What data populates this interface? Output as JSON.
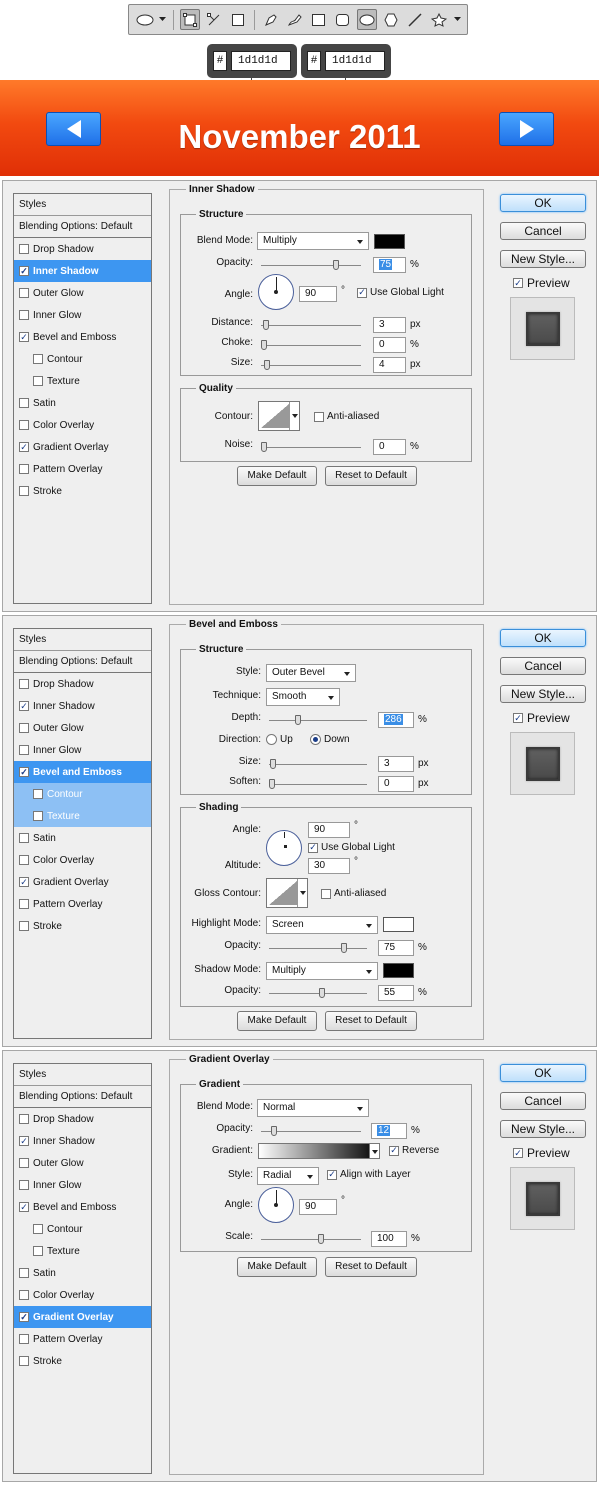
{
  "toolbar": {
    "tools": [
      "ellipse-icon",
      "dropdown-arrow-icon",
      "shape-layers-icon",
      "paths-icon",
      "fill-pixels-icon",
      "pen-icon",
      "freeform-pen-icon",
      "rectangle-icon",
      "rounded-rectangle-icon",
      "ellipse-icon",
      "polygon-icon",
      "line-icon",
      "custom-shape-icon",
      "dropdown-arrow-icon"
    ]
  },
  "hex_left": {
    "hash": "#",
    "value": "1d1d1d"
  },
  "hex_right": {
    "hash": "#",
    "value": "1d1d1d"
  },
  "banner": {
    "title": "November 2011",
    "prev": "◀",
    "next": "▶",
    "colors": {
      "top": "#ff7a2a",
      "bottom": "#e02f06",
      "button": "#2b83f0"
    }
  },
  "common": {
    "styles_header": "Styles",
    "blending": "Blending Options: Default",
    "ok": "OK",
    "cancel": "Cancel",
    "new_style": "New Style...",
    "preview": "Preview",
    "make_default": "Make Default",
    "reset_default": "Reset to Default",
    "check": "✓"
  },
  "panel1": {
    "items": [
      {
        "label": "Drop Shadow",
        "checked": false
      },
      {
        "label": "Inner Shadow",
        "checked": true
      },
      {
        "label": "Outer Glow",
        "checked": false
      },
      {
        "label": "Inner Glow",
        "checked": false
      },
      {
        "label": "Bevel and Emboss",
        "checked": true
      },
      {
        "label": "Contour",
        "checked": false
      },
      {
        "label": "Texture",
        "checked": false
      },
      {
        "label": "Satin",
        "checked": false
      },
      {
        "label": "Color Overlay",
        "checked": false
      },
      {
        "label": "Gradient Overlay",
        "checked": true
      },
      {
        "label": "Pattern Overlay",
        "checked": false
      },
      {
        "label": "Stroke",
        "checked": false
      }
    ],
    "title": "Inner Shadow",
    "structure": "Structure",
    "blend_mode_label": "Blend Mode:",
    "blend_mode": "Multiply",
    "swatch_color": "#000000",
    "opacity_label": "Opacity:",
    "opacity": "75",
    "angle_label": "Angle:",
    "angle": "90",
    "deg": "°",
    "global_light": "Use Global Light",
    "distance_label": "Distance:",
    "distance": "3",
    "choke_label": "Choke:",
    "choke": "0",
    "size_label": "Size:",
    "size": "4",
    "quality": "Quality",
    "contour_label": "Contour:",
    "anti_aliased": "Anti-aliased",
    "noise_label": "Noise:",
    "noise": "0",
    "px": "px",
    "pct": "%"
  },
  "panel2": {
    "items": [
      {
        "label": "Drop Shadow",
        "checked": false
      },
      {
        "label": "Inner Shadow",
        "checked": true
      },
      {
        "label": "Outer Glow",
        "checked": false
      },
      {
        "label": "Inner Glow",
        "checked": false
      },
      {
        "label": "Bevel and Emboss",
        "checked": true
      },
      {
        "label": "Contour",
        "checked": false
      },
      {
        "label": "Texture",
        "checked": false
      },
      {
        "label": "Satin",
        "checked": false
      },
      {
        "label": "Color Overlay",
        "checked": false
      },
      {
        "label": "Gradient Overlay",
        "checked": true
      },
      {
        "label": "Pattern Overlay",
        "checked": false
      },
      {
        "label": "Stroke",
        "checked": false
      }
    ],
    "title": "Bevel and Emboss",
    "structure": "Structure",
    "style_label": "Style:",
    "style": "Outer Bevel",
    "technique_label": "Technique:",
    "technique": "Smooth",
    "depth_label": "Depth:",
    "depth": "286",
    "direction_label": "Direction:",
    "up": "Up",
    "down": "Down",
    "size_label": "Size:",
    "size": "3",
    "soften_label": "Soften:",
    "soften": "0",
    "shading": "Shading",
    "angle_label": "Angle:",
    "angle": "90",
    "deg": "°",
    "global_light": "Use Global Light",
    "altitude_label": "Altitude:",
    "altitude": "30",
    "gloss_label": "Gloss Contour:",
    "anti_aliased": "Anti-aliased",
    "highlight_label": "Highlight Mode:",
    "highlight_mode": "Screen",
    "highlight_color": "#ffffff",
    "hl_opacity_label": "Opacity:",
    "hl_opacity": "75",
    "shadow_label": "Shadow Mode:",
    "shadow_mode": "Multiply",
    "shadow_color": "#000000",
    "sh_opacity_label": "Opacity:",
    "sh_opacity": "55",
    "px": "px",
    "pct": "%"
  },
  "panel3": {
    "items": [
      {
        "label": "Drop Shadow",
        "checked": false
      },
      {
        "label": "Inner Shadow",
        "checked": true
      },
      {
        "label": "Outer Glow",
        "checked": false
      },
      {
        "label": "Inner Glow",
        "checked": false
      },
      {
        "label": "Bevel and Emboss",
        "checked": true
      },
      {
        "label": "Contour",
        "checked": false
      },
      {
        "label": "Texture",
        "checked": false
      },
      {
        "label": "Satin",
        "checked": false
      },
      {
        "label": "Color Overlay",
        "checked": false
      },
      {
        "label": "Gradient Overlay",
        "checked": true
      },
      {
        "label": "Pattern Overlay",
        "checked": false
      },
      {
        "label": "Stroke",
        "checked": false
      }
    ],
    "title": "Gradient Overlay",
    "gradient_group": "Gradient",
    "blend_mode_label": "Blend Mode:",
    "blend_mode": "Normal",
    "opacity_label": "Opacity:",
    "opacity": "12",
    "gradient_label": "Gradient:",
    "reverse": "Reverse",
    "style_label": "Style:",
    "style": "Radial",
    "align": "Align with Layer",
    "angle_label": "Angle:",
    "angle": "90",
    "deg": "°",
    "scale_label": "Scale:",
    "scale": "100",
    "pct": "%"
  }
}
